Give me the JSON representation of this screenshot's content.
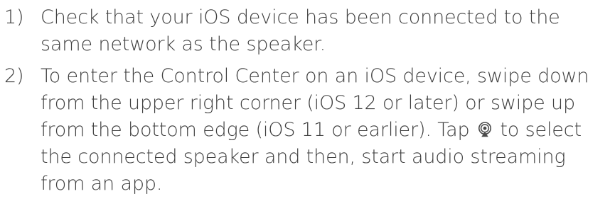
{
  "steps": [
    {
      "number": "1)",
      "text": "Check that your iOS device has been connected to the same network as the speaker."
    },
    {
      "number": "2)",
      "text_before_icon": "To enter the Control Center on an iOS device, swipe down from the upper right corner (iOS 12 or later) or swipe up from the bottom edge (iOS 11 or earlier). Tap ",
      "icon": "airplay-audio-icon",
      "text_after_icon": " to select the connected speaker and then, start audio streaming from an app."
    }
  ],
  "colors": {
    "text": "#3f3f3f",
    "background": "#ffffff"
  }
}
